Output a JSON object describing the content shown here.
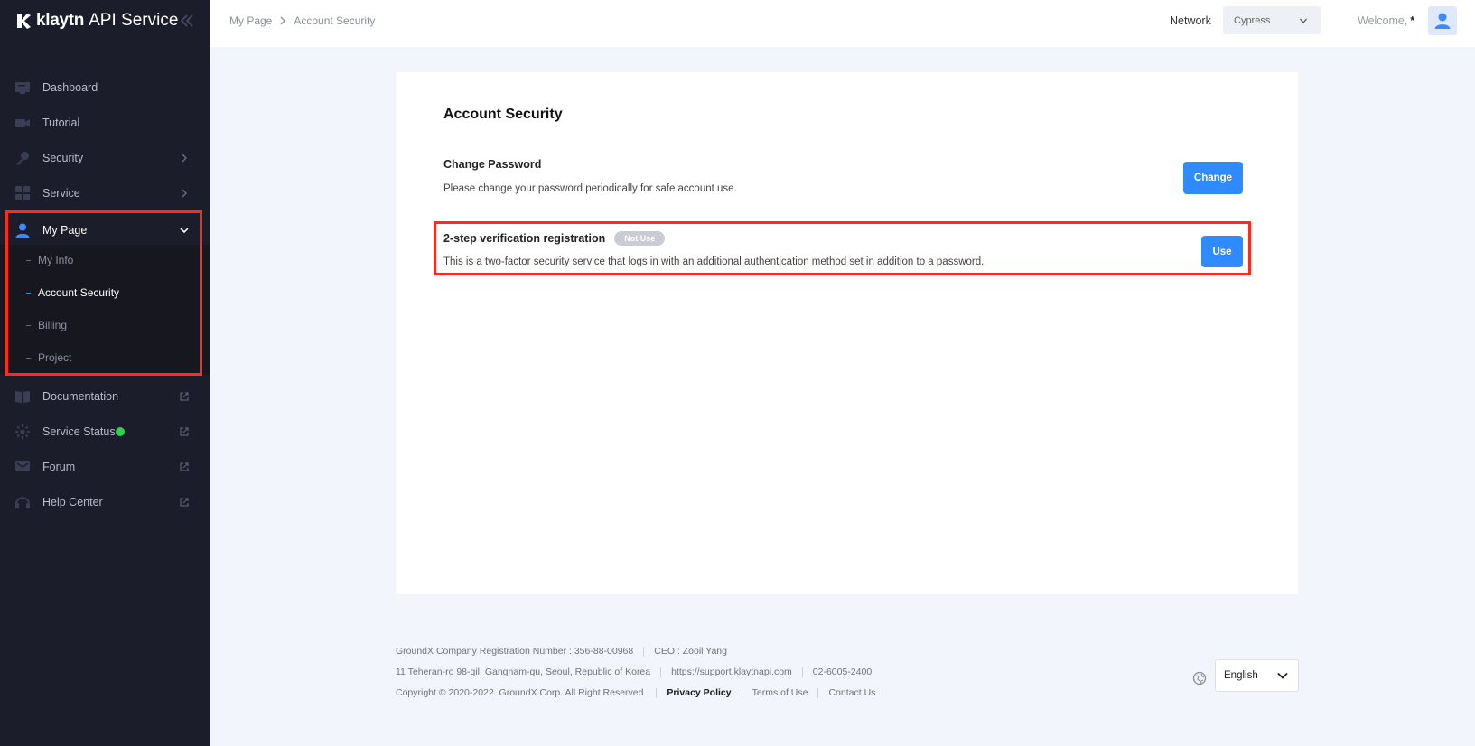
{
  "brand": {
    "logo": "klaytn",
    "subtitle": "API Service"
  },
  "sidebar": {
    "items": [
      {
        "label": "Dashboard",
        "icon": "dashboard-icon"
      },
      {
        "label": "Tutorial",
        "icon": "video-icon"
      },
      {
        "label": "Security",
        "icon": "key-icon"
      },
      {
        "label": "Service",
        "icon": "grid-icon"
      },
      {
        "label": "My Page",
        "icon": "user-icon"
      },
      {
        "label": "Documentation",
        "icon": "book-icon"
      },
      {
        "label": "Service Status",
        "icon": "status-icon"
      },
      {
        "label": "Forum",
        "icon": "forum-icon"
      },
      {
        "label": "Help Center",
        "icon": "headset-icon"
      }
    ],
    "mypage_sub": [
      {
        "label": "My Info"
      },
      {
        "label": "Account Security"
      },
      {
        "label": "Billing"
      },
      {
        "label": "Project"
      }
    ],
    "status_color": "#2fd24f"
  },
  "topbar": {
    "breadcrumb": [
      "My Page",
      "Account Security"
    ],
    "network_label": "Network",
    "network_value": "Cypress",
    "welcome_prefix": "Welcome,",
    "welcome_user": "*"
  },
  "main": {
    "title": "Account Security",
    "change_password": {
      "title": "Change Password",
      "desc": "Please change your password periodically for safe account use.",
      "button": "Change"
    },
    "two_factor": {
      "title": "2-step verification registration",
      "badge": "Not Use",
      "desc": "This is a two-factor security service that logs in with an additional authentication method set in addition to a password.",
      "button": "Use"
    }
  },
  "footer": {
    "reg_number": "GroundX Company Registration Number : 356-88-00968",
    "ceo": "CEO : Zooil Yang",
    "address": "11 Teheran-ro 98-gil, Gangnam-gu, Seoul, Republic of Korea",
    "support_url": "https://support.klaytnapi.com",
    "phone": "02-6005-2400",
    "copyright": "Copyright © 2020-2022. GroundX Corp. All Right Reserved.",
    "privacy": "Privacy Policy",
    "terms": "Terms of Use",
    "contact": "Contact Us",
    "language": "English"
  },
  "colors": {
    "accent": "#2f8bff",
    "sidebar_bg": "#1c1d2b",
    "highlight": "#ff2a1a"
  }
}
